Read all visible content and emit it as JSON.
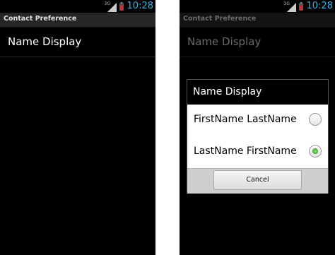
{
  "left": {
    "status": {
      "network": "3G",
      "time": "10:28"
    },
    "title_bar": {
      "title": "Contact Preference"
    },
    "preference": {
      "title": "Name Display"
    }
  },
  "right": {
    "status": {
      "network": "3G",
      "time": "10:28"
    },
    "title_bar": {
      "title": "Contact Preference"
    },
    "preference": {
      "title": "Name Display"
    },
    "dialog": {
      "title": "Name Display",
      "options": [
        {
          "label": "FirstName LastName",
          "selected": false
        },
        {
          "label": "LastName FirstName",
          "selected": true
        }
      ],
      "cancel_label": "Cancel"
    }
  },
  "colors": {
    "clock": "#33b5e5",
    "radio_selected": "#6dd04a",
    "battery": "#d42a2a"
  }
}
